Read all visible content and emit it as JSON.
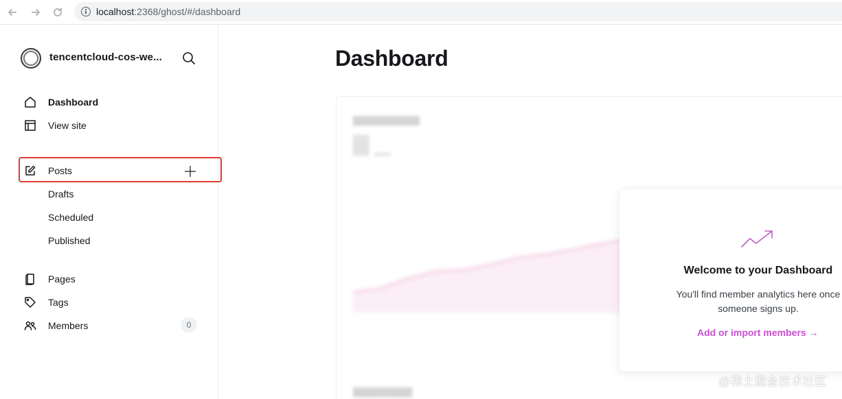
{
  "browser": {
    "url_host": "localhost",
    "url_path": ":2368/ghost/#/dashboard"
  },
  "sidebar": {
    "site_title": "tencentcloud-cos-we...",
    "primary": [
      {
        "label": "Dashboard",
        "icon": "home-icon"
      },
      {
        "label": "View site",
        "icon": "layout-icon"
      }
    ],
    "posts": {
      "label": "Posts",
      "icon": "edit-icon",
      "sub_items": [
        "Drafts",
        "Scheduled",
        "Published"
      ]
    },
    "secondary": [
      {
        "label": "Pages",
        "icon": "page-icon"
      },
      {
        "label": "Tags",
        "icon": "tag-icon"
      },
      {
        "label": "Members",
        "icon": "members-icon",
        "count": "0"
      }
    ]
  },
  "main": {
    "title": "Dashboard",
    "welcome": {
      "title": "Welcome to your Dashboard",
      "text": "You'll find member analytics here once someone signs up.",
      "link": "Add or import members →"
    }
  },
  "watermark": "@稀土掘金技术社区",
  "colors": {
    "accent": "#c84fd1",
    "highlight_border": "#e0382e"
  }
}
